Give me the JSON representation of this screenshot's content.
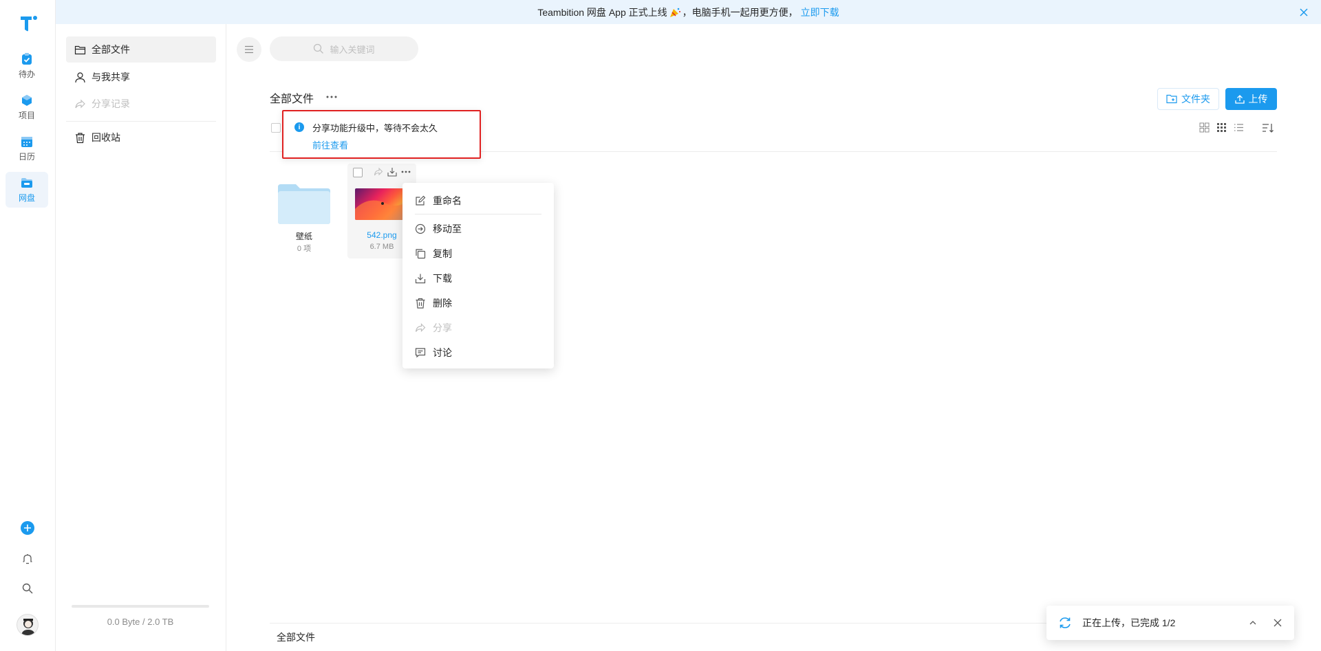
{
  "banner": {
    "text": "Teambition 网盘 App 正式上线",
    "text_after_icon": "，电脑手机一起用更方便，",
    "link": "立即下载"
  },
  "rail": {
    "items": [
      {
        "label": "待办",
        "icon": "todo-icon"
      },
      {
        "label": "项目",
        "icon": "project-icon"
      },
      {
        "label": "日历",
        "icon": "calendar-icon"
      },
      {
        "label": "网盘",
        "icon": "drive-icon"
      }
    ]
  },
  "sidebar": {
    "items": [
      {
        "label": "全部文件",
        "icon": "folder-icon"
      },
      {
        "label": "与我共享",
        "icon": "user-icon"
      },
      {
        "label": "分享记录",
        "icon": "share-icon"
      },
      {
        "label": "回收站",
        "icon": "trash-icon"
      }
    ],
    "storage": "0.0 Byte / 2.0 TB"
  },
  "search": {
    "placeholder": "输入关键词"
  },
  "main": {
    "title": "全部文件",
    "new_folder_label": "文件夹",
    "upload_label": "上传"
  },
  "notice": {
    "message": "分享功能升级中，等待不会太久",
    "link": "前往查看"
  },
  "files": [
    {
      "name": "壁纸",
      "meta": "0 项",
      "type": "folder"
    },
    {
      "name": "542.png",
      "meta": "6.7 MB",
      "type": "image"
    }
  ],
  "context_menu": {
    "items": [
      {
        "label": "重命名",
        "icon": "edit-icon"
      },
      {
        "label": "移动至",
        "icon": "move-icon"
      },
      {
        "label": "复制",
        "icon": "copy-icon"
      },
      {
        "label": "下载",
        "icon": "download-icon"
      },
      {
        "label": "删除",
        "icon": "delete-icon"
      },
      {
        "label": "分享",
        "icon": "share-icon",
        "disabled": true
      },
      {
        "label": "讨论",
        "icon": "comment-icon"
      }
    ]
  },
  "footer": {
    "breadcrumb": "全部文件"
  },
  "upload_toast": {
    "text": "正在上传，已完成 1/2"
  },
  "colors": {
    "accent": "#1b9aee",
    "highlight_border": "#e02020"
  }
}
